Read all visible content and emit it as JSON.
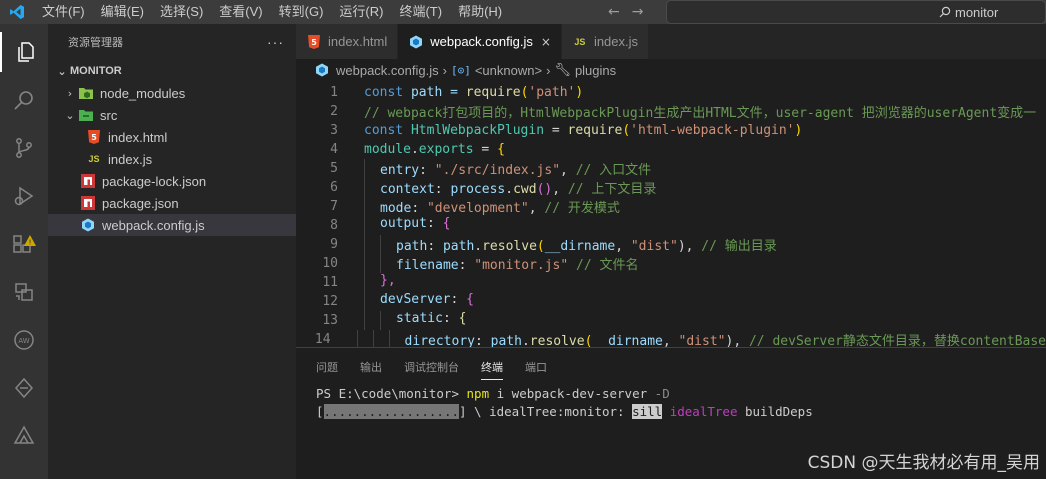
{
  "menu": [
    "文件(F)",
    "编辑(E)",
    "选择(S)",
    "查看(V)",
    "转到(G)",
    "运行(R)",
    "终端(T)",
    "帮助(H)"
  ],
  "search": {
    "text": "monitor",
    "icon": "search-icon"
  },
  "activity_icons": [
    "explorer-icon",
    "search-icon",
    "source-control-icon",
    "run-debug-icon",
    "extensions-icon",
    "remote-explorer-icon",
    "aws-icon",
    "gitlens-icon",
    "tree-icon"
  ],
  "sidebar": {
    "title": "资源管理器",
    "more": "···",
    "section": "MONITOR",
    "items": [
      {
        "label": "node_modules",
        "chevron": "›",
        "icon": "folder-node-icon"
      },
      {
        "label": "src",
        "chevron": "⌄",
        "icon": "folder-src-icon"
      },
      {
        "label": "index.html",
        "icon": "html-icon",
        "badge": "5"
      },
      {
        "label": "index.js",
        "icon": "js-icon",
        "badge": "JS"
      },
      {
        "label": "package-lock.json",
        "icon": "npm-icon"
      },
      {
        "label": "package.json",
        "icon": "npm-icon"
      },
      {
        "label": "webpack.config.js",
        "icon": "webpack-icon"
      }
    ]
  },
  "tabs": [
    {
      "label": "index.html",
      "badge": "5"
    },
    {
      "label": "webpack.config.js",
      "close": "×"
    },
    {
      "label": "index.js",
      "badge": "JS"
    }
  ],
  "breadcrumb": [
    "webpack.config.js",
    "›",
    "<unknown>",
    "›",
    "plugins"
  ],
  "code_lines": [
    "1",
    "2",
    "3",
    "4",
    "5",
    "6",
    "7",
    "8",
    "9",
    "10",
    "11",
    "12",
    "13",
    "14"
  ],
  "code": {
    "l1": [
      "const",
      " path = ",
      "require",
      "(",
      "'path'",
      ")"
    ],
    "l2": "// webpack打包项目的，HtmlWebpackPlugin生成产出HTML文件，user-agent 把浏览器的userAgent变成一",
    "l3": [
      "const",
      " ",
      "HtmlWebpackPlugin",
      " = ",
      "require",
      "(",
      "'html-webpack-plugin'",
      ")"
    ],
    "l4": [
      "module",
      ".",
      "exports",
      " = ",
      "{"
    ],
    "l5": [
      "entry",
      ": ",
      "\"./src/index.js\"",
      ", ",
      "// 入口文件"
    ],
    "l6": [
      "context",
      ": ",
      "process",
      ".",
      "cwd",
      "()",
      ", ",
      "// 上下文目录"
    ],
    "l7": [
      "mode",
      ": ",
      "\"development\"",
      ", ",
      "// 开发模式"
    ],
    "l8": [
      "output",
      ": ",
      "{"
    ],
    "l9": [
      "path",
      ": ",
      "path",
      ".",
      "resolve",
      "(",
      "__dirname",
      ", ",
      "\"dist\"",
      "), ",
      "// 输出目录"
    ],
    "l10": [
      "filename",
      ": ",
      "\"monitor.js\"",
      " ",
      "// 文件名"
    ],
    "l11": "},",
    "l12": [
      "devServer",
      ": ",
      "{"
    ],
    "l13": [
      "static",
      ": ",
      "{"
    ],
    "l14": [
      "directory",
      ": ",
      "path",
      ".",
      "resolve",
      "(",
      "__dirname",
      ", ",
      "\"dist\"",
      "), ",
      "// devServer静态文件目录，替换contentBase"
    ]
  },
  "panel": {
    "tabs": [
      "问题",
      "输出",
      "调试控制台",
      "终端",
      "端口"
    ],
    "active": "终端"
  },
  "terminal": {
    "prompt": "PS E:\\code\\monitor> ",
    "cmd": "npm",
    "args": " i webpack-dev-server ",
    "flag": "-D",
    "progress_open": "[",
    "progress_bar": "..................",
    "progress_close": "] \\ idealTree:monitor: ",
    "sill": "sill",
    "space": " ",
    "ideal": "idealTree",
    "rest": " buildDeps"
  },
  "watermark": "CSDN @天生我材必有用_吴用"
}
